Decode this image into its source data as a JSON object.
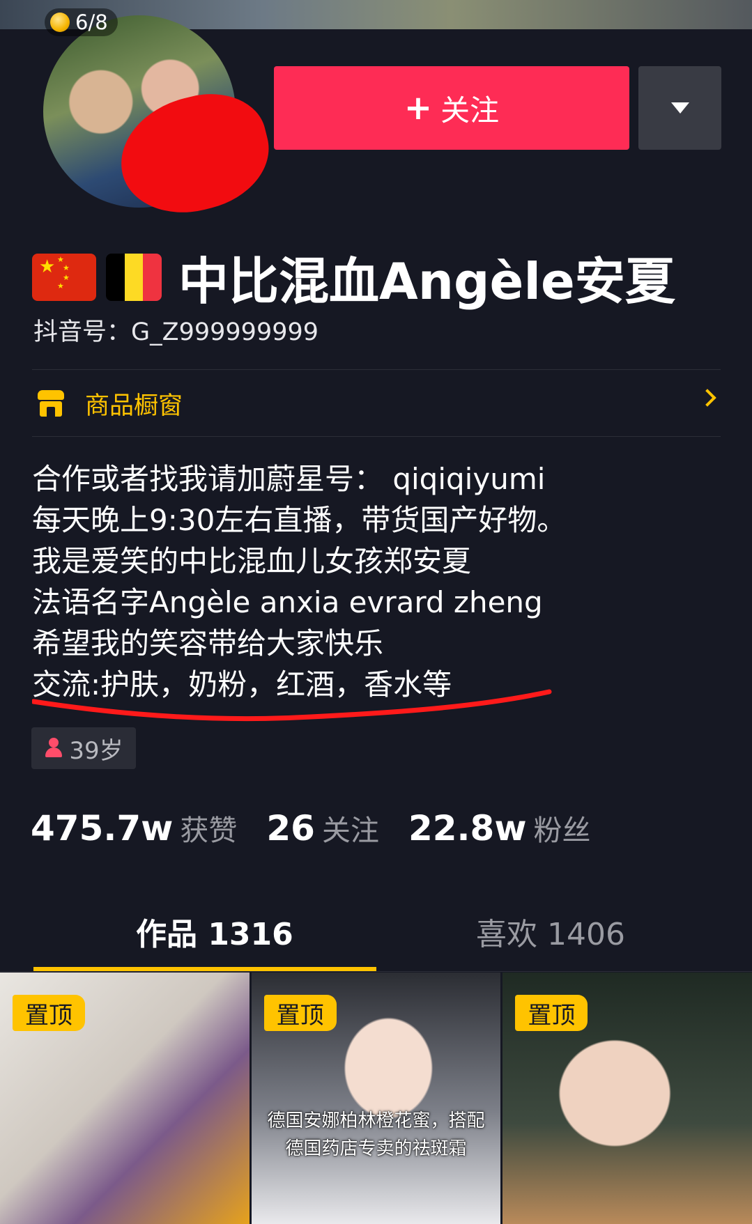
{
  "header": {
    "photo_counter": "6/8",
    "follow_button": "关注",
    "dropdown_icon": "caret-down-icon"
  },
  "profile": {
    "flags": [
      "china-flag",
      "belgium-flag"
    ],
    "username": "中比混血Angèle安夏",
    "douyin_id": "抖音号：G_Z999999999",
    "shop_label": "商品橱窗",
    "bio": [
      "合作或者找我请加蔚星号：  qiqiqiyumi",
      "每天晚上9:30左右直播，带货国产好物。",
      "我是爱笑的中比混血儿女孩郑安夏",
      "法语名字Angèle anxia evrard zheng",
      "希望我的笑容带给大家快乐",
      "交流:护肤，奶粉，红酒，香水等"
    ],
    "age_tag": "39岁"
  },
  "stats": [
    {
      "num": "475.7w",
      "label": "获赞"
    },
    {
      "num": "26",
      "label": "关注"
    },
    {
      "num": "22.8w",
      "label": "粉丝"
    }
  ],
  "tabs": {
    "works": "作品 1316",
    "likes": "喜欢 1406"
  },
  "videos": [
    {
      "badge": "置顶",
      "caption": []
    },
    {
      "badge": "置顶",
      "caption": [
        "德国安娜柏林橙花蜜，搭配",
        "德国药店专卖的祛斑霜"
      ]
    },
    {
      "badge": "置顶",
      "caption": []
    }
  ],
  "colors": {
    "background": "#161823",
    "follow": "#fe2c55",
    "accent": "#ffc300",
    "redaction": "#f20c10"
  }
}
